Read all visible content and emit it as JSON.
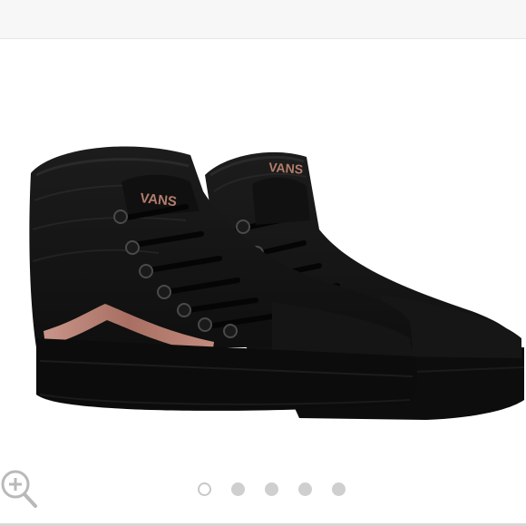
{
  "product_image": {
    "brand_logo_text": "VANS",
    "stripe_color": "#b07a6c",
    "shoe_color": "#131313",
    "sole_color": "#0d0d0d"
  },
  "gallery": {
    "total_images": 5,
    "active_index": 0
  },
  "toolbar": {
    "zoom_icon": "zoom-in-icon"
  },
  "colors": {
    "top_bar": "#f7f7f7",
    "dot_inactive": "#cfcfcf",
    "dot_active_border": "#c8c8c8"
  }
}
